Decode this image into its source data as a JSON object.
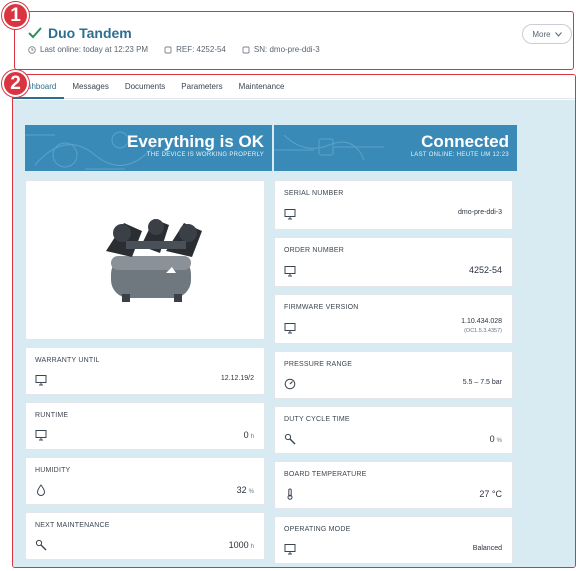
{
  "header": {
    "title": "Duo Tandem",
    "last_online": "Last online: today at 12:23 PM",
    "ref": "REF: 4252-54",
    "sn": "SN: dmo-pre-ddi-3",
    "more_label": "More"
  },
  "callouts": [
    "1",
    "2"
  ],
  "tabs": [
    {
      "label": "ashboard",
      "active": true
    },
    {
      "label": "Messages"
    },
    {
      "label": "Documents"
    },
    {
      "label": "Parameters"
    },
    {
      "label": "Maintenance"
    }
  ],
  "banners": {
    "status": {
      "main": "Everything is OK",
      "sub": "THE DEVICE IS WORKING PROPERLY"
    },
    "connection": {
      "main": "Connected",
      "sub": "LAST ONLINE: HEUTE UM 12:23"
    }
  },
  "cards_left": [
    {
      "label": "WARRANTY UNTIL",
      "value": "12.12.19/2",
      "icon": "monitor-icon"
    },
    {
      "label": "RUNTIME",
      "value": "0",
      "unit": "h",
      "icon": "monitor-icon"
    },
    {
      "label": "HUMIDITY",
      "value": "32",
      "unit": "%",
      "icon": "droplet-icon"
    },
    {
      "label": "NEXT MAINTENANCE",
      "value": "1000",
      "unit": "h",
      "icon": "wrench-icon"
    }
  ],
  "cards_right": [
    {
      "label": "SERIAL NUMBER",
      "value": "dmo-pre-ddi-3",
      "icon": "monitor-icon"
    },
    {
      "label": "ORDER NUMBER",
      "value": "4252-54",
      "icon": "monitor-icon"
    },
    {
      "label": "FIRMWARE VERSION",
      "value": "1.10.434.028",
      "sub": "(OC1.5.3.4357)",
      "icon": "monitor-icon"
    },
    {
      "label": "PRESSURE RANGE",
      "value": "5.5 – 7.5 bar",
      "icon": "gauge-icon"
    },
    {
      "label": "DUTY CYCLE TIME",
      "value": "0",
      "unit": "%",
      "icon": "wrench-icon"
    },
    {
      "label": "BOARD TEMPERATURE",
      "value": "27 °C",
      "icon": "thermometer-icon"
    },
    {
      "label": "OPERATING MODE",
      "value": "Balanced",
      "icon": "monitor-icon"
    }
  ],
  "colors": {
    "accent": "#2e6f8f",
    "banner": "#3a8ab8",
    "content_bg": "#d8ebf3",
    "callout": "#d9343f"
  }
}
